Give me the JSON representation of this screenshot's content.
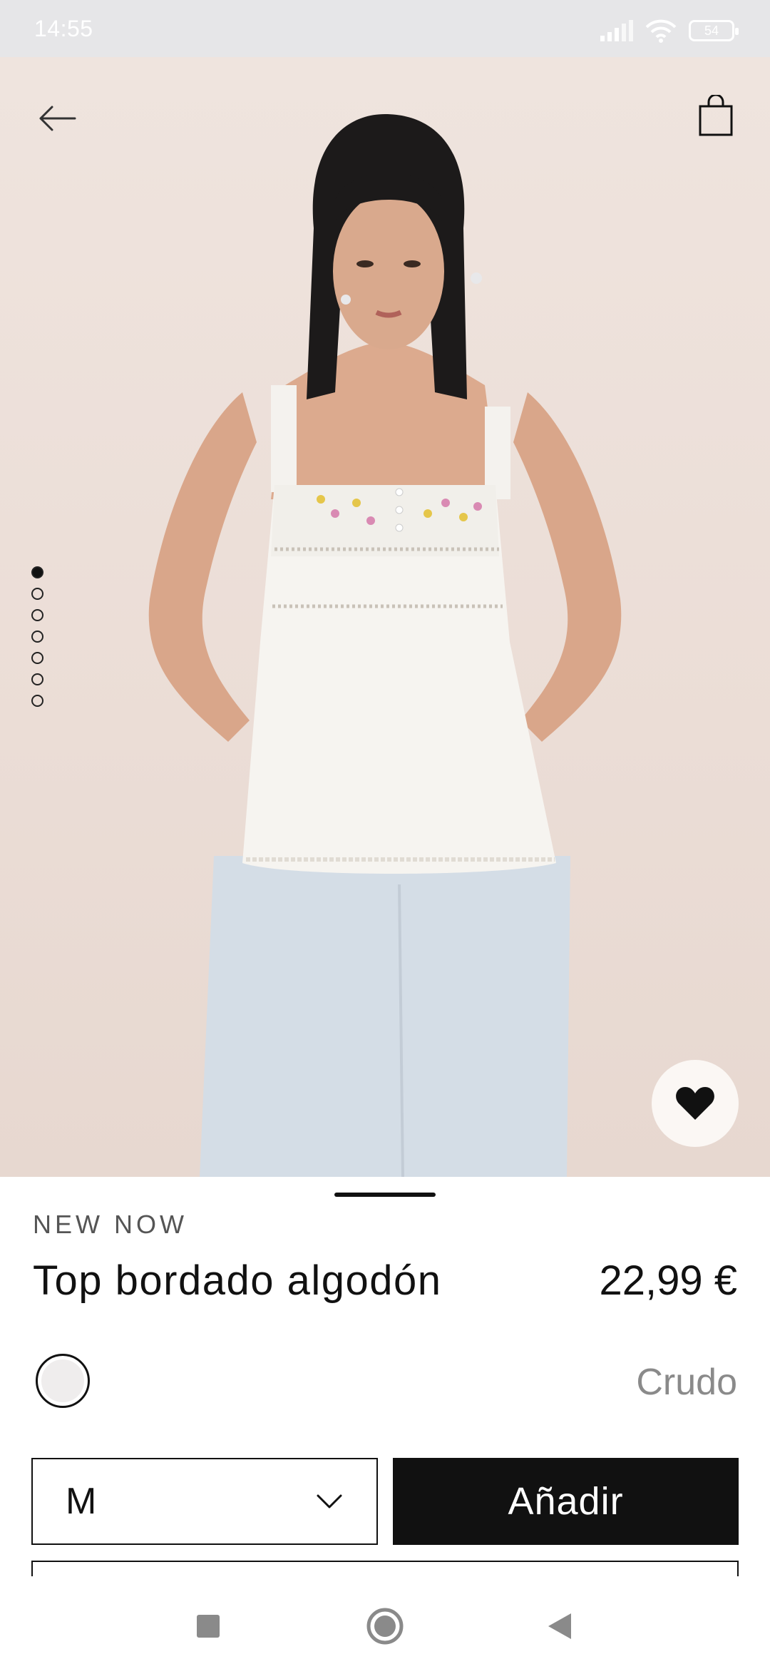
{
  "status": {
    "time": "14:55",
    "battery": "54"
  },
  "product": {
    "eyebrow": "NEW NOW",
    "title": "Top bordado algodón",
    "price": "22,99 €",
    "color_name": "Crudo",
    "swatch_color": "#efeded",
    "size_value": "M",
    "add_label": "Añadir"
  },
  "gallery": {
    "total_images": 7,
    "active_index": 0
  },
  "icons": {
    "back": "arrow-left-icon",
    "bag": "shopping-bag-icon",
    "favorite": "heart-icon",
    "size_dropdown": "chevron-down-icon",
    "nav_recents": "square-icon",
    "nav_home": "circle-icon",
    "nav_back": "triangle-back-icon"
  },
  "colors": {
    "accent": "#111111",
    "background_photo": "#ebddd6"
  }
}
